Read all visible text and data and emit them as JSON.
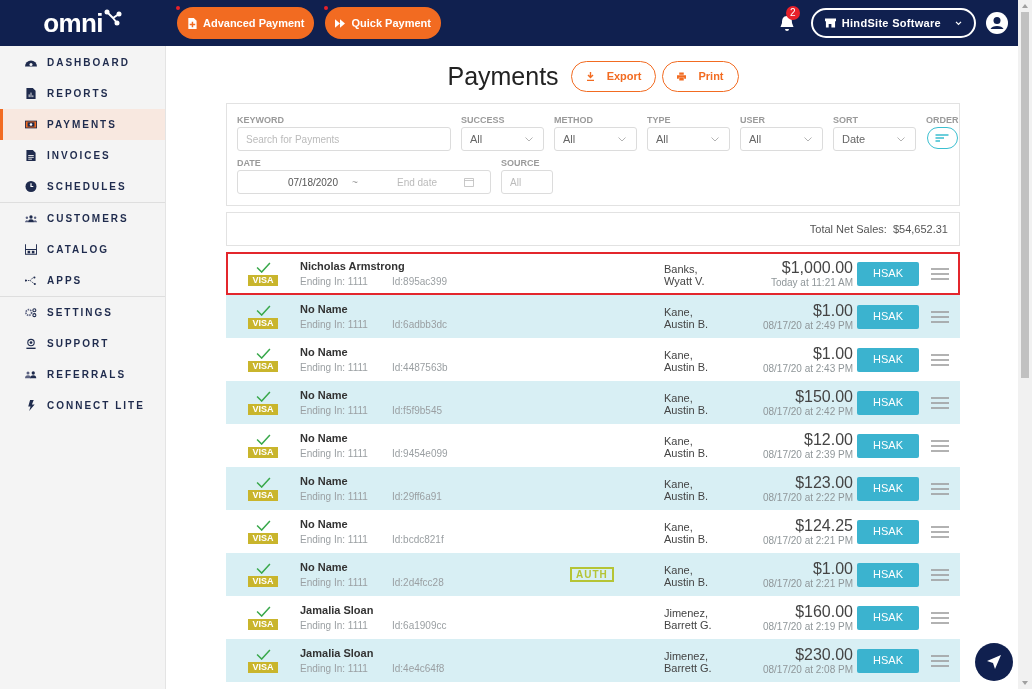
{
  "header": {
    "logo": "omni",
    "buttons": [
      {
        "label": "Advanced Payment",
        "kind": "doc"
      },
      {
        "label": "Quick Payment",
        "kind": "forward"
      }
    ],
    "notification_count": "2",
    "account": "HindSite Software"
  },
  "sidebar": {
    "groups": [
      [
        {
          "label": "DASHBOARD",
          "selected": false
        },
        {
          "label": "REPORTS",
          "selected": false
        },
        {
          "label": "PAYMENTS",
          "selected": true
        },
        {
          "label": "INVOICES",
          "selected": false
        },
        {
          "label": "SCHEDULES",
          "selected": false
        }
      ],
      [
        {
          "label": "CUSTOMERS",
          "selected": false
        },
        {
          "label": "CATALOG",
          "selected": false
        },
        {
          "label": "APPS",
          "selected": false
        }
      ],
      [
        {
          "label": "SETTINGS",
          "selected": false
        },
        {
          "label": "SUPPORT",
          "selected": false
        },
        {
          "label": "REFERRALS",
          "selected": false
        },
        {
          "label": "CONNECT LITE",
          "selected": false
        }
      ]
    ]
  },
  "page": {
    "title": "Payments",
    "actions": [
      {
        "label": "Export",
        "kind": "download"
      },
      {
        "label": "Print",
        "kind": "print"
      }
    ]
  },
  "filters": {
    "row_1": [
      {
        "label": "KEYWORD",
        "kind": "text",
        "placeholder": "Search for Payments"
      },
      {
        "label": "SUCCESS",
        "kind": "select",
        "value": "All"
      },
      {
        "label": "METHOD",
        "kind": "select",
        "value": "All"
      },
      {
        "label": "TYPE",
        "kind": "select",
        "value": "All"
      },
      {
        "label": "USER",
        "kind": "select",
        "value": "All"
      },
      {
        "label": "SORT",
        "kind": "select",
        "value": "Date"
      },
      {
        "label": "ORDER",
        "kind": "order"
      }
    ],
    "row_2": [
      {
        "label": "DATE",
        "kind": "daterange",
        "value": "07/18/2020",
        "separator": "~",
        "placeholder": "End date"
      },
      {
        "label": "SOURCE",
        "kind": "input",
        "placeholder": "All"
      }
    ]
  },
  "total": {
    "label": "Total Net Sales:",
    "value": "$54,652.31"
  },
  "payments": [
    {
      "success": true,
      "card": "VISA",
      "name": "Nicholas Armstrong",
      "ending": "Ending In: 1111",
      "id": "Id:895ac399",
      "user": [
        "Banks,",
        "Wyatt V."
      ],
      "amount": "$1,000.00",
      "time": "Today at 11:21 AM",
      "terminal": "HSAK",
      "selected": true
    },
    {
      "success": true,
      "card": "VISA",
      "name": "No Name",
      "ending": "Ending In: 1111",
      "id": "Id:6adbb3dc",
      "user": [
        "Kane,",
        "Austin B."
      ],
      "amount": "$1.00",
      "time": "08/17/20 at 2:49 PM",
      "terminal": "HSAK",
      "selected": false
    },
    {
      "success": true,
      "card": "VISA",
      "name": "No Name",
      "ending": "Ending In: 1111",
      "id": "Id:4487563b",
      "user": [
        "Kane,",
        "Austin B."
      ],
      "amount": "$1.00",
      "time": "08/17/20 at 2:43 PM",
      "terminal": "HSAK",
      "selected": false
    },
    {
      "success": true,
      "card": "VISA",
      "name": "No Name",
      "ending": "Ending In: 1111",
      "id": "Id:f5f9b545",
      "user": [
        "Kane,",
        "Austin B."
      ],
      "amount": "$150.00",
      "time": "08/17/20 at 2:42 PM",
      "terminal": "HSAK",
      "selected": false
    },
    {
      "success": true,
      "card": "VISA",
      "name": "No Name",
      "ending": "Ending In: 1111",
      "id": "Id:9454e099",
      "user": [
        "Kane,",
        "Austin B."
      ],
      "amount": "$12.00",
      "time": "08/17/20 at 2:39 PM",
      "terminal": "HSAK",
      "selected": false
    },
    {
      "success": true,
      "card": "VISA",
      "name": "No Name",
      "ending": "Ending In: 1111",
      "id": "Id:29ff6a91",
      "user": [
        "Kane,",
        "Austin B."
      ],
      "amount": "$123.00",
      "time": "08/17/20 at 2:22 PM",
      "terminal": "HSAK",
      "selected": false
    },
    {
      "success": true,
      "card": "VISA",
      "name": "No Name",
      "ending": "Ending In: 1111",
      "id": "Id:bcdc821f",
      "user": [
        "Kane,",
        "Austin B."
      ],
      "amount": "$124.25",
      "time": "08/17/20 at 2:21 PM",
      "terminal": "HSAK",
      "selected": false
    },
    {
      "success": true,
      "card": "VISA",
      "name": "No Name",
      "ending": "Ending In: 1111",
      "id": "Id:2d4fcc28",
      "badge": "AUTH",
      "user": [
        "Kane,",
        "Austin B."
      ],
      "amount": "$1.00",
      "time": "08/17/20 at 2:21 PM",
      "terminal": "HSAK",
      "selected": false
    },
    {
      "success": true,
      "card": "VISA",
      "name": "Jamalia Sloan",
      "ending": "Ending In: 1111",
      "id": "Id:6a1909cc",
      "user": [
        "Jimenez,",
        "Barrett G."
      ],
      "amount": "$160.00",
      "time": "08/17/20 at 2:19 PM",
      "terminal": "HSAK",
      "selected": false
    },
    {
      "success": true,
      "card": "VISA",
      "name": "Jamalia Sloan",
      "ending": "Ending In: 1111",
      "id": "Id:4e4c64f8",
      "user": [
        "Jimenez,",
        "Barrett G."
      ],
      "amount": "$230.00",
      "time": "08/17/20 at 2:08 PM",
      "terminal": "HSAK",
      "selected": false
    }
  ]
}
